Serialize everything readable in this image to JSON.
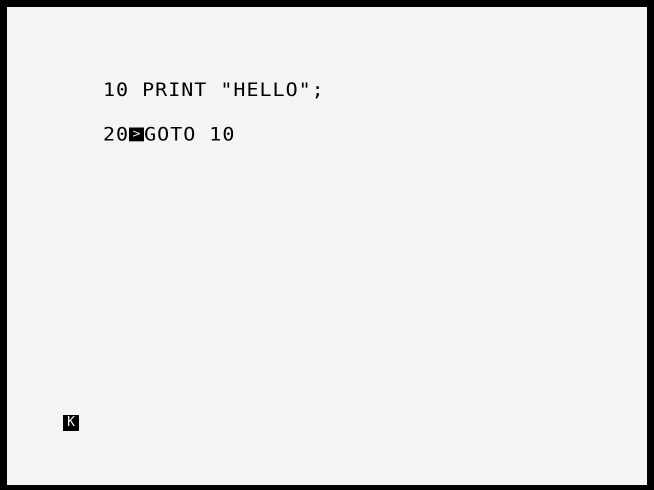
{
  "window": {
    "border_color": "#000000",
    "paper_color": "#f4f4f4",
    "ink_color": "#000000"
  },
  "program": {
    "lines": [
      {
        "number": "10",
        "text": " PRINT \"HELLO\";"
      },
      {
        "number": "20",
        "cursor": ">",
        "text": "GOTO 10"
      }
    ]
  },
  "status": {
    "cursor_mode": "K"
  }
}
